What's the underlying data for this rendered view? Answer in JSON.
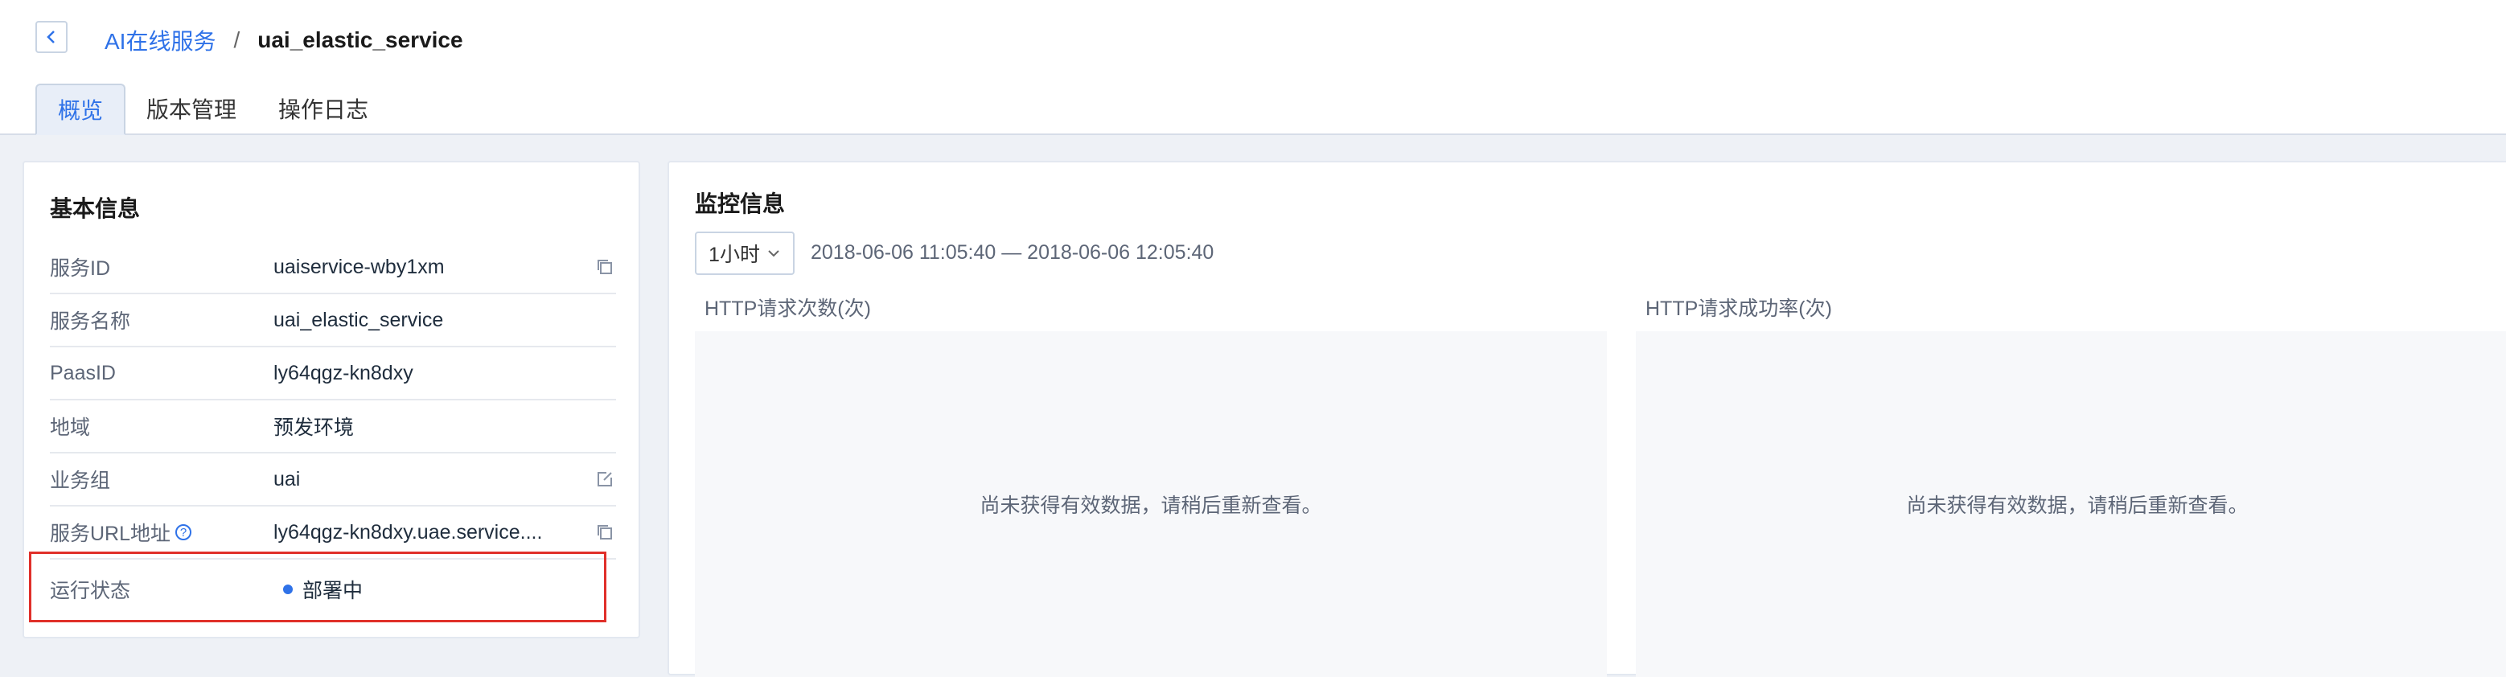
{
  "breadcrumb": {
    "parent": "AI在线服务",
    "separator": "/",
    "current": "uai_elastic_service"
  },
  "tabs": [
    {
      "label": "概览",
      "active": true
    },
    {
      "label": "版本管理",
      "active": false
    },
    {
      "label": "操作日志",
      "active": false
    }
  ],
  "basic_info": {
    "title": "基本信息",
    "rows": [
      {
        "label": "服务ID",
        "value": "uaiservice-wby1xm",
        "action_icon": "copy-icon"
      },
      {
        "label": "服务名称",
        "value": "uai_elastic_service"
      },
      {
        "label": "PaasID",
        "value": "ly64qgz-kn8dxy"
      },
      {
        "label": "地域",
        "value": "预发环境"
      },
      {
        "label": "业务组",
        "value": "uai",
        "action_icon": "edit-icon"
      },
      {
        "label": "服务URL地址",
        "value": "ly64qgz-kn8dxy.uae.service....",
        "help_icon": "help-icon",
        "action_icon": "copy-icon"
      },
      {
        "label": "运行状态",
        "value": "部署中",
        "status_color": "#2f72e8"
      }
    ]
  },
  "monitor": {
    "title": "监控信息",
    "range_select": "1小时",
    "time_range": "2018-06-06 11:05:40 — 2018-06-06 12:05:40",
    "charts": [
      {
        "title": "HTTP请求次数(次)",
        "empty_text": "尚未获得有效数据，请稍后重新查看。"
      },
      {
        "title": "HTTP请求成功率(次)",
        "empty_text": "尚未获得有效数据，请稍后重新查看。"
      }
    ]
  },
  "colors": {
    "accent": "#2f72e8",
    "highlight_border": "#e0302a"
  }
}
